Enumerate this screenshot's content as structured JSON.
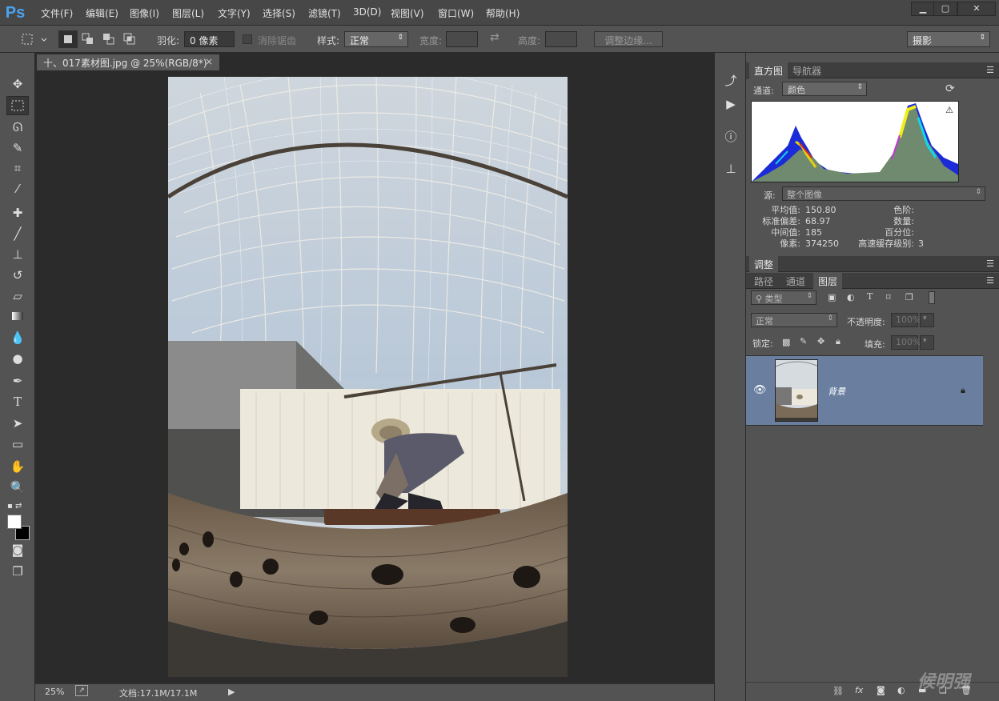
{
  "app": {
    "logo": "Ps"
  },
  "menu": [
    "文件(F)",
    "编辑(E)",
    "图像(I)",
    "图层(L)",
    "文字(Y)",
    "选择(S)",
    "滤镜(T)",
    "3D(D)",
    "视图(V)",
    "窗口(W)",
    "帮助(H)"
  ],
  "window_controls": {
    "minimize": "▁",
    "maximize": "▢",
    "close": "✕"
  },
  "options_bar": {
    "feather_label": "羽化:",
    "feather_value": "0 像素",
    "antialias_label": "消除锯齿",
    "style_label": "样式:",
    "style_value": "正常",
    "width_label": "宽度:",
    "height_label": "高度:",
    "refine_edge_button": "调整边缘...",
    "workspace_value": "摄影"
  },
  "document": {
    "tab_title": "十、017素材图.jpg @ 25%(RGB/8*)",
    "tab_close": "×",
    "zoom": "25%",
    "doc_size": "文档:17.1M/17.1M"
  },
  "histogram_panel": {
    "tabs": [
      "直方图",
      "导航器"
    ],
    "channel_label": "通道:",
    "channel_value": "颜色",
    "source_label": "源:",
    "source_value": "整个图像",
    "stats_left": [
      {
        "label": "平均值:",
        "value": "150.80"
      },
      {
        "label": "标准偏差:",
        "value": "68.97"
      },
      {
        "label": "中间值:",
        "value": "185"
      },
      {
        "label": "像素:",
        "value": "374250"
      }
    ],
    "stats_right": [
      {
        "label": "色阶:",
        "value": ""
      },
      {
        "label": "数量:",
        "value": ""
      },
      {
        "label": "百分位:",
        "value": ""
      },
      {
        "label": "高速缓存级别:",
        "value": "3"
      }
    ]
  },
  "adjust_panel": {
    "tab": "调整"
  },
  "layers_panel": {
    "tabs": [
      "路径",
      "通道",
      "图层"
    ],
    "filter_value": "类型",
    "blend_mode": "正常",
    "opacity_label": "不透明度:",
    "opacity_value": "100%",
    "lock_label": "锁定:",
    "fill_label": "填充:",
    "fill_value": "100%",
    "layers": [
      {
        "name": "背景"
      }
    ]
  },
  "watermark": "候明强",
  "colors": {
    "accent": "#4aa3f0",
    "layer_selected": "#6a7fa0"
  }
}
